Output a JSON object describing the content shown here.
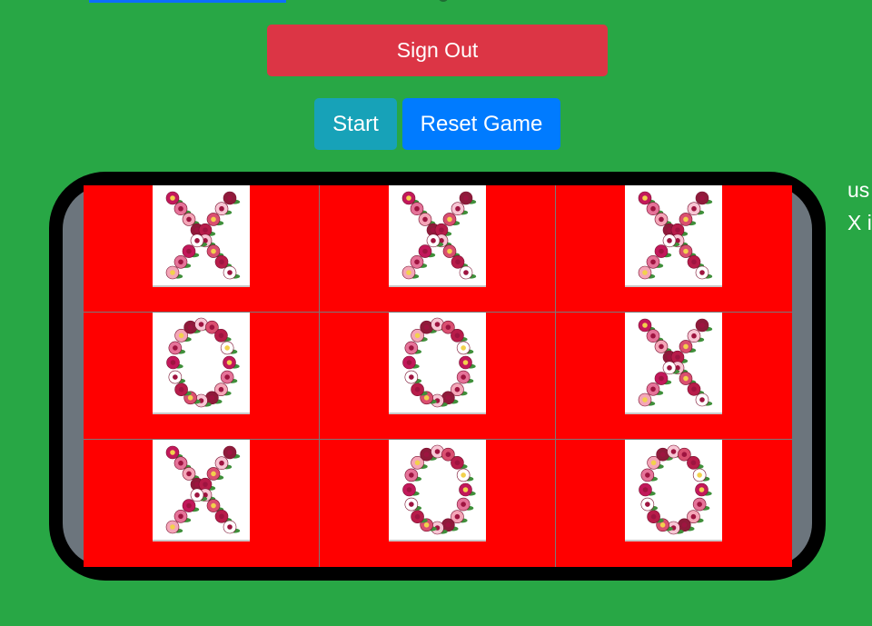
{
  "header": {
    "sign_out_label": "Sign Out",
    "start_label": "Start",
    "reset_label": "Reset Game"
  },
  "board": {
    "cells": [
      "X",
      "X",
      "X",
      "O",
      "O",
      "X",
      "X",
      "O",
      "O"
    ]
  },
  "side_panel": {
    "line1": "us",
    "line2": "X i"
  },
  "colors": {
    "background": "#28a745",
    "sign_out": "#dc3545",
    "start": "#17a2b8",
    "reset": "#007bff",
    "cell": "#ff0000",
    "frame": "#000000",
    "frame_inner": "#6c757d"
  }
}
